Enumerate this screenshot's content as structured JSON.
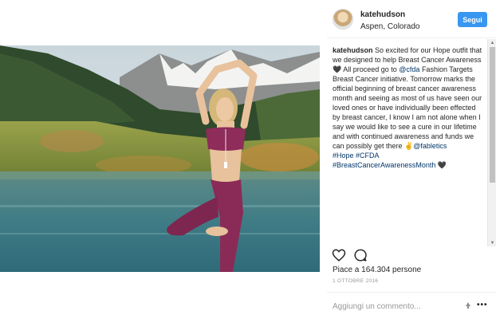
{
  "post": {
    "username": "katehudson",
    "location": "Aspen, Colorado",
    "follow_label": "Segui",
    "caption": {
      "user": "katehudson",
      "text_1": " So excited for our Hope outfit that we designed to help Breast Cancer Awareness ",
      "heart_1": "🖤",
      "text_2": " All proceed go to ",
      "mention_1": "@cfda",
      "text_3": " Fashion Targets Breast Cancer initiative. Tomorrow marks the official beginning of breast cancer awareness month and seeing as most of us have seen our loved ones or have individually been effected by breast cancer, I know I am not alone when I say we would like to see a cure in our lifetime and with continued awareness and funds we can possibly get there ",
      "hand": "✌",
      "mention_2": "@fabletics",
      "tag_1": "#Hope",
      "tag_2": "#CFDA",
      "tag_3": "#BreastCancerAwarenessMonth",
      "heart_2": "🖤"
    },
    "likes": "Piace a 164.304 persone",
    "date": "1 OTTOBRE 2016",
    "comment_placeholder": "Aggiungi un commento...",
    "more": "•••"
  },
  "icons": {
    "heart": "heart-icon",
    "comment": "comment-icon",
    "emoji": "emoji-icon",
    "more": "more-options-icon"
  },
  "colors": {
    "follow_button": "#3897f0",
    "link": "#003569",
    "muted": "#999999"
  }
}
